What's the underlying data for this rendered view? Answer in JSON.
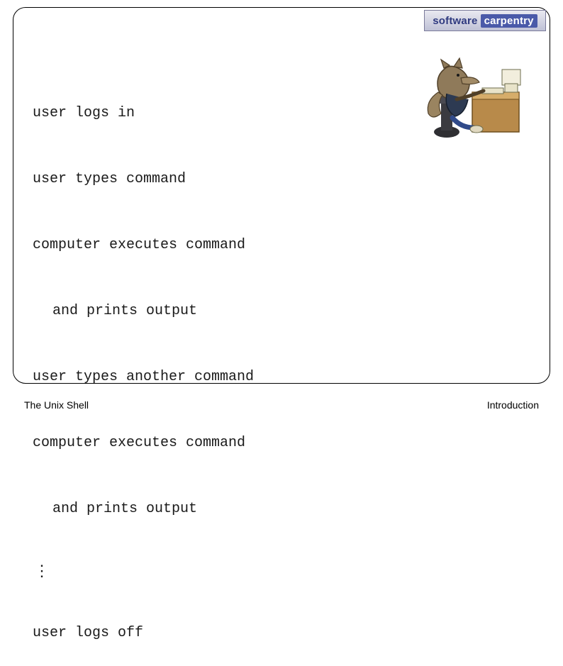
{
  "logo": {
    "word1": "software",
    "word2": "carpentry"
  },
  "content": {
    "lines": [
      {
        "text": "user logs in",
        "indent": false
      },
      {
        "text": "user types command",
        "indent": false
      },
      {
        "text": "computer executes command",
        "indent": false
      },
      {
        "text": "and prints output",
        "indent": true
      },
      {
        "text": "user types another command",
        "indent": false
      },
      {
        "text": "computer executes command",
        "indent": false
      },
      {
        "text": "and prints output",
        "indent": true
      }
    ],
    "ellipsis": "⋮",
    "final_line": "user logs off"
  },
  "footer": {
    "left": "The Unix Shell",
    "right": "Introduction"
  },
  "illustration": {
    "name": "wolf-at-computer"
  }
}
